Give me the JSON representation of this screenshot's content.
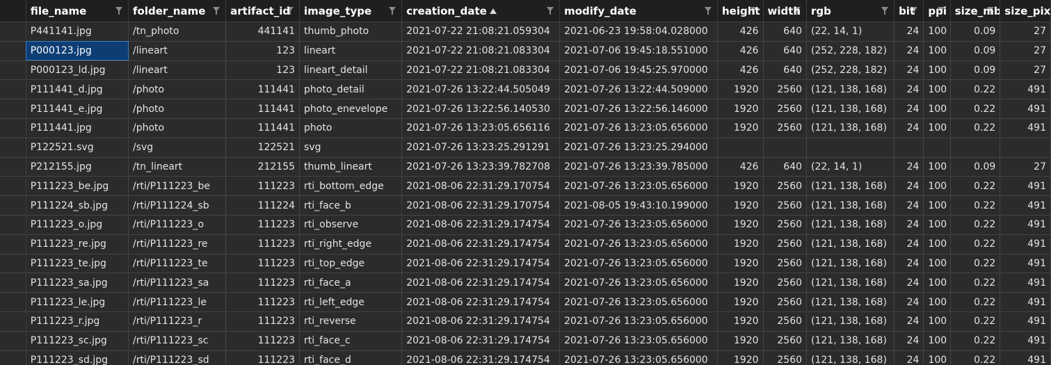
{
  "columns": [
    {
      "key": "file_name",
      "label": "file_name",
      "filter": true
    },
    {
      "key": "folder_name",
      "label": "folder_name",
      "filter": true
    },
    {
      "key": "artifact_id",
      "label": "artifact_id",
      "filter": true
    },
    {
      "key": "image_type",
      "label": "image_type",
      "filter": true
    },
    {
      "key": "creation_date",
      "label": "creation_date",
      "filter": true,
      "sort": "asc"
    },
    {
      "key": "modify_date",
      "label": "modify_date",
      "filter": true
    },
    {
      "key": "height",
      "label": "height",
      "filter": true
    },
    {
      "key": "width",
      "label": "width",
      "filter": true
    },
    {
      "key": "rgb",
      "label": "rgb",
      "filter": true
    },
    {
      "key": "bit",
      "label": "bit",
      "filter": true
    },
    {
      "key": "ppi",
      "label": "ppi",
      "filter": true
    },
    {
      "key": "size_mb",
      "label": "size_mb",
      "filter": true
    },
    {
      "key": "size_pix",
      "label": "size_pix",
      "filter": false
    }
  ],
  "selected": {
    "row": 1,
    "col": "file_name"
  },
  "rows": [
    {
      "file_name": "P441141.jpg",
      "folder_name": "/tn_photo",
      "artifact_id": "441141",
      "image_type": "thumb_photo",
      "creation_date": "2021-07-22 21:08:21.059304",
      "modify_date": "2021-06-23 19:58:04.028000",
      "height": "426",
      "width": "640",
      "rgb": "(22, 14, 1)",
      "bit": "24",
      "ppi": "100",
      "size_mb": "0.09",
      "size_pix": "27"
    },
    {
      "file_name": "P000123.jpg",
      "folder_name": "/lineart",
      "artifact_id": "123",
      "image_type": "lineart",
      "creation_date": "2021-07-22 21:08:21.083304",
      "modify_date": "2021-07-06 19:45:18.551000",
      "height": "426",
      "width": "640",
      "rgb": "(252, 228, 182)",
      "bit": "24",
      "ppi": "100",
      "size_mb": "0.09",
      "size_pix": "27"
    },
    {
      "file_name": "P000123_ld.jpg",
      "folder_name": "/lineart",
      "artifact_id": "123",
      "image_type": "lineart_detail",
      "creation_date": "2021-07-22 21:08:21.083304",
      "modify_date": "2021-07-06 19:45:25.970000",
      "height": "426",
      "width": "640",
      "rgb": "(252, 228, 182)",
      "bit": "24",
      "ppi": "100",
      "size_mb": "0.09",
      "size_pix": "27"
    },
    {
      "file_name": "P111441_d.jpg",
      "folder_name": "/photo",
      "artifact_id": "111441",
      "image_type": "photo_detail",
      "creation_date": "2021-07-26 13:22:44.505049",
      "modify_date": "2021-07-26 13:22:44.509000",
      "height": "1920",
      "width": "2560",
      "rgb": "(121, 138, 168)",
      "bit": "24",
      "ppi": "100",
      "size_mb": "0.22",
      "size_pix": "491"
    },
    {
      "file_name": "P111441_e.jpg",
      "folder_name": "/photo",
      "artifact_id": "111441",
      "image_type": "photo_enevelope",
      "creation_date": "2021-07-26 13:22:56.140530",
      "modify_date": "2021-07-26 13:22:56.146000",
      "height": "1920",
      "width": "2560",
      "rgb": "(121, 138, 168)",
      "bit": "24",
      "ppi": "100",
      "size_mb": "0.22",
      "size_pix": "491"
    },
    {
      "file_name": "P111441.jpg",
      "folder_name": "/photo",
      "artifact_id": "111441",
      "image_type": "photo",
      "creation_date": "2021-07-26 13:23:05.656116",
      "modify_date": "2021-07-26 13:23:05.656000",
      "height": "1920",
      "width": "2560",
      "rgb": "(121, 138, 168)",
      "bit": "24",
      "ppi": "100",
      "size_mb": "0.22",
      "size_pix": "491"
    },
    {
      "file_name": "P122521.svg",
      "folder_name": "/svg",
      "artifact_id": "122521",
      "image_type": "svg",
      "creation_date": "2021-07-26 13:23:25.291291",
      "modify_date": "2021-07-26 13:23:25.294000",
      "height": "",
      "width": "",
      "rgb": "",
      "bit": "",
      "ppi": "",
      "size_mb": "",
      "size_pix": ""
    },
    {
      "file_name": "P212155.jpg",
      "folder_name": "/tn_lineart",
      "artifact_id": "212155",
      "image_type": "thumb_lineart",
      "creation_date": "2021-07-26 13:23:39.782708",
      "modify_date": "2021-07-26 13:23:39.785000",
      "height": "426",
      "width": "640",
      "rgb": "(22, 14, 1)",
      "bit": "24",
      "ppi": "100",
      "size_mb": "0.09",
      "size_pix": "27"
    },
    {
      "file_name": "P111223_be.jpg",
      "folder_name": "/rti/P111223_be",
      "artifact_id": "111223",
      "image_type": "rti_bottom_edge",
      "creation_date": "2021-08-06 22:31:29.170754",
      "modify_date": "2021-07-26 13:23:05.656000",
      "height": "1920",
      "width": "2560",
      "rgb": "(121, 138, 168)",
      "bit": "24",
      "ppi": "100",
      "size_mb": "0.22",
      "size_pix": "491"
    },
    {
      "file_name": "P111224_sb.jpg",
      "folder_name": "/rti/P111224_sb",
      "artifact_id": "111224",
      "image_type": "rti_face_b",
      "creation_date": "2021-08-06 22:31:29.170754",
      "modify_date": "2021-08-05 19:43:10.199000",
      "height": "1920",
      "width": "2560",
      "rgb": "(121, 138, 168)",
      "bit": "24",
      "ppi": "100",
      "size_mb": "0.22",
      "size_pix": "491"
    },
    {
      "file_name": "P111223_o.jpg",
      "folder_name": "/rti/P111223_o",
      "artifact_id": "111223",
      "image_type": "rti_observe",
      "creation_date": "2021-08-06 22:31:29.174754",
      "modify_date": "2021-07-26 13:23:05.656000",
      "height": "1920",
      "width": "2560",
      "rgb": "(121, 138, 168)",
      "bit": "24",
      "ppi": "100",
      "size_mb": "0.22",
      "size_pix": "491"
    },
    {
      "file_name": "P111223_re.jpg",
      "folder_name": "/rti/P111223_re",
      "artifact_id": "111223",
      "image_type": "rti_right_edge",
      "creation_date": "2021-08-06 22:31:29.174754",
      "modify_date": "2021-07-26 13:23:05.656000",
      "height": "1920",
      "width": "2560",
      "rgb": "(121, 138, 168)",
      "bit": "24",
      "ppi": "100",
      "size_mb": "0.22",
      "size_pix": "491"
    },
    {
      "file_name": "P111223_te.jpg",
      "folder_name": "/rti/P111223_te",
      "artifact_id": "111223",
      "image_type": "rti_top_edge",
      "creation_date": "2021-08-06 22:31:29.174754",
      "modify_date": "2021-07-26 13:23:05.656000",
      "height": "1920",
      "width": "2560",
      "rgb": "(121, 138, 168)",
      "bit": "24",
      "ppi": "100",
      "size_mb": "0.22",
      "size_pix": "491"
    },
    {
      "file_name": "P111223_sa.jpg",
      "folder_name": "/rti/P111223_sa",
      "artifact_id": "111223",
      "image_type": "rti_face_a",
      "creation_date": "2021-08-06 22:31:29.174754",
      "modify_date": "2021-07-26 13:23:05.656000",
      "height": "1920",
      "width": "2560",
      "rgb": "(121, 138, 168)",
      "bit": "24",
      "ppi": "100",
      "size_mb": "0.22",
      "size_pix": "491"
    },
    {
      "file_name": "P111223_le.jpg",
      "folder_name": "/rti/P111223_le",
      "artifact_id": "111223",
      "image_type": "rti_left_edge",
      "creation_date": "2021-08-06 22:31:29.174754",
      "modify_date": "2021-07-26 13:23:05.656000",
      "height": "1920",
      "width": "2560",
      "rgb": "(121, 138, 168)",
      "bit": "24",
      "ppi": "100",
      "size_mb": "0.22",
      "size_pix": "491"
    },
    {
      "file_name": "P111223_r.jpg",
      "folder_name": "/rti/P111223_r",
      "artifact_id": "111223",
      "image_type": "rti_reverse",
      "creation_date": "2021-08-06 22:31:29.174754",
      "modify_date": "2021-07-26 13:23:05.656000",
      "height": "1920",
      "width": "2560",
      "rgb": "(121, 138, 168)",
      "bit": "24",
      "ppi": "100",
      "size_mb": "0.22",
      "size_pix": "491"
    },
    {
      "file_name": "P111223_sc.jpg",
      "folder_name": "/rti/P111223_sc",
      "artifact_id": "111223",
      "image_type": "rti_face_c",
      "creation_date": "2021-08-06 22:31:29.174754",
      "modify_date": "2021-07-26 13:23:05.656000",
      "height": "1920",
      "width": "2560",
      "rgb": "(121, 138, 168)",
      "bit": "24",
      "ppi": "100",
      "size_mb": "0.22",
      "size_pix": "491"
    },
    {
      "file_name": "P111223_sd.jpg",
      "folder_name": "/rti/P111223_sd",
      "artifact_id": "111223",
      "image_type": "rti_face_d",
      "creation_date": "2021-08-06 22:31:29.174754",
      "modify_date": "2021-07-26 13:23:05.656000",
      "height": "1920",
      "width": "2560",
      "rgb": "(121, 138, 168)",
      "bit": "24",
      "ppi": "100",
      "size_mb": "0.22",
      "size_pix": "491"
    }
  ]
}
